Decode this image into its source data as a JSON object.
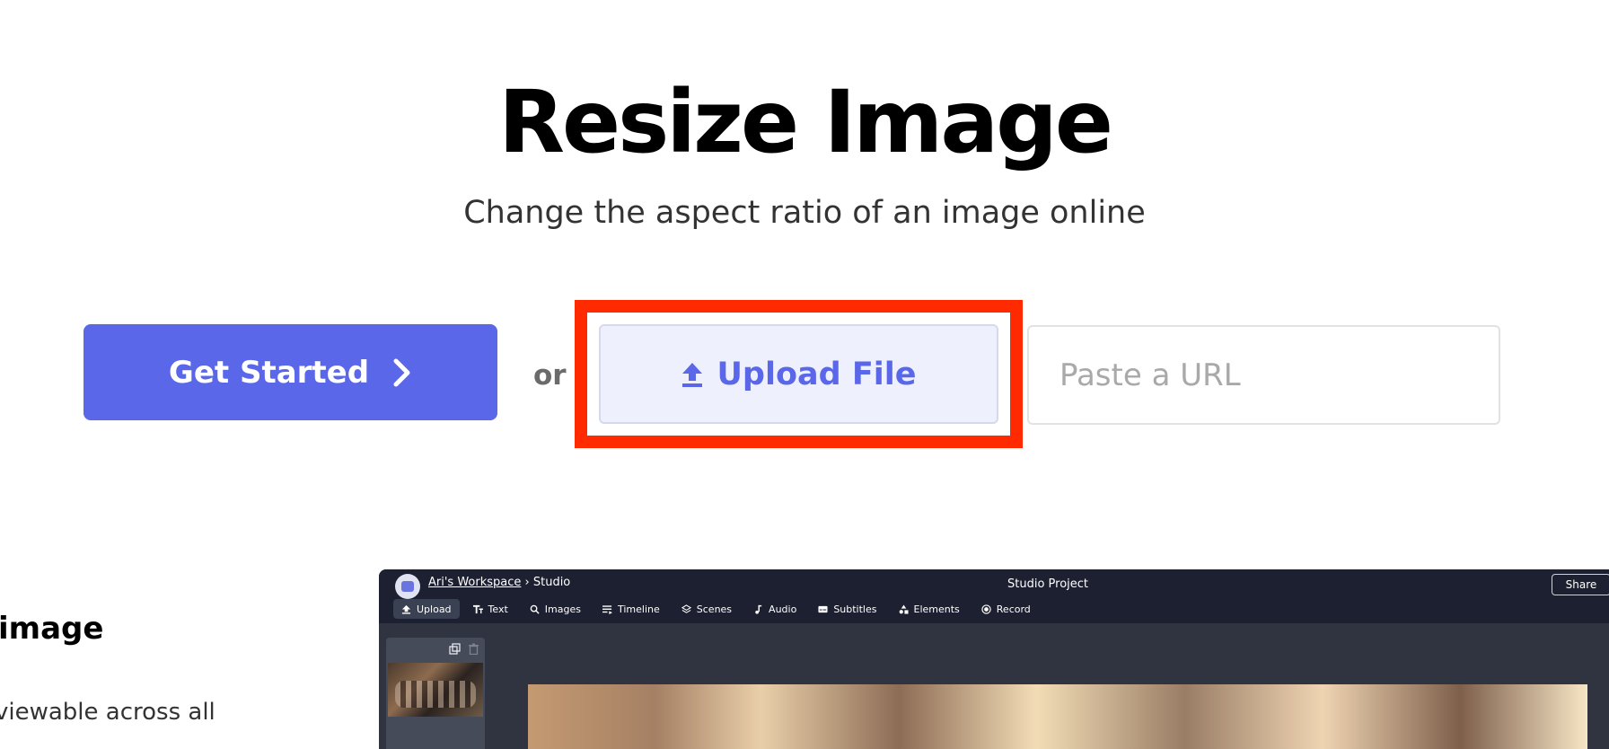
{
  "hero": {
    "title": "Resize Image",
    "subtitle": "Change the aspect ratio of an image online"
  },
  "actions": {
    "get_started_label": "Get Started",
    "or_label": "or",
    "upload_label": "Upload File",
    "url_placeholder": "Paste a URL"
  },
  "feature": {
    "heading": "y image",
    "text": "viewable across all"
  },
  "editor": {
    "workspace_link": "Ari's Workspace",
    "crumb_separator": " › ",
    "crumb_current": "Studio",
    "project_title": "Studio Project",
    "share_label": "Share",
    "tools": [
      {
        "label": "Upload",
        "icon": "upload-icon"
      },
      {
        "label": "Text",
        "icon": "text-icon"
      },
      {
        "label": "Images",
        "icon": "search-icon"
      },
      {
        "label": "Timeline",
        "icon": "timeline-icon"
      },
      {
        "label": "Scenes",
        "icon": "layers-icon"
      },
      {
        "label": "Audio",
        "icon": "music-note-icon"
      },
      {
        "label": "Subtitles",
        "icon": "subtitles-icon"
      },
      {
        "label": "Elements",
        "icon": "shapes-icon"
      },
      {
        "label": "Record",
        "icon": "record-icon"
      }
    ]
  },
  "colors": {
    "primary": "#5a67e8",
    "highlight": "#ff2a00",
    "upload_bg": "#eef0fd",
    "editor_bg": "#2f3440",
    "editor_bar": "#1c2030"
  }
}
